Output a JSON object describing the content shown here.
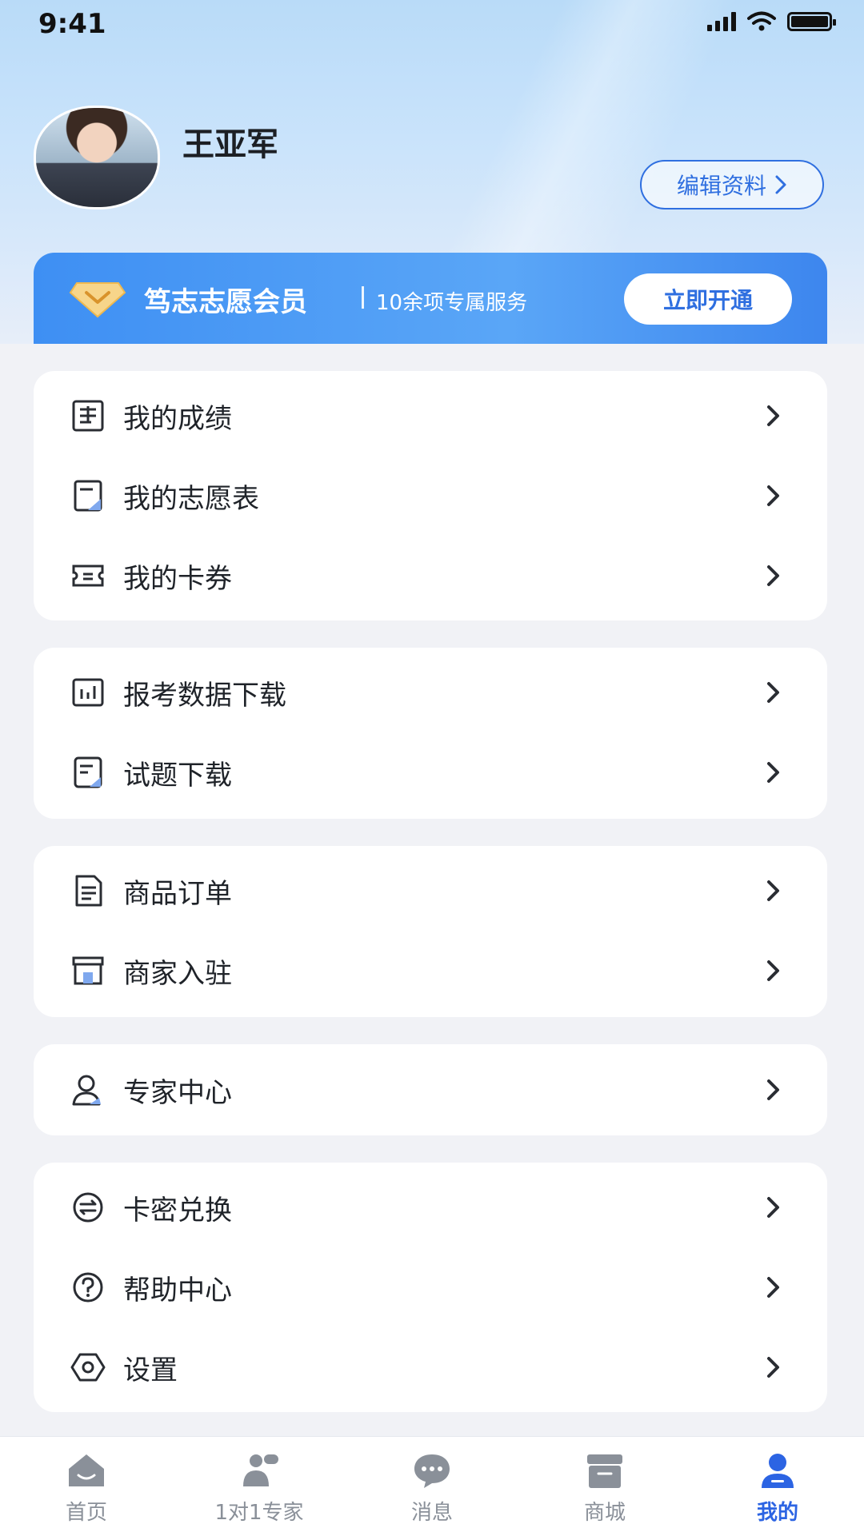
{
  "status_bar": {
    "time": "9:41"
  },
  "profile": {
    "name": "王亚军",
    "edit_label": "编辑资料"
  },
  "vip": {
    "title": "笃志志愿会员",
    "subtitle": "10余项专属服务",
    "action": "立即开通"
  },
  "menu": {
    "group1": [
      "我的成绩",
      "我的志愿表",
      "我的卡券"
    ],
    "group2": [
      "报考数据下载",
      "试题下载"
    ],
    "group3": [
      "商品订单",
      "商家入驻"
    ],
    "group4": [
      "专家中心"
    ],
    "group5": [
      "卡密兑换",
      "帮助中心",
      "设置"
    ]
  },
  "tabbar": {
    "items": [
      "首页",
      "1对1专家",
      "消息",
      "商城",
      "我的"
    ],
    "active": "我的"
  },
  "colors": {
    "accent": "#2c64e3",
    "vip_banner": "#4a98f5",
    "inactive_tab": "#8a9099"
  }
}
